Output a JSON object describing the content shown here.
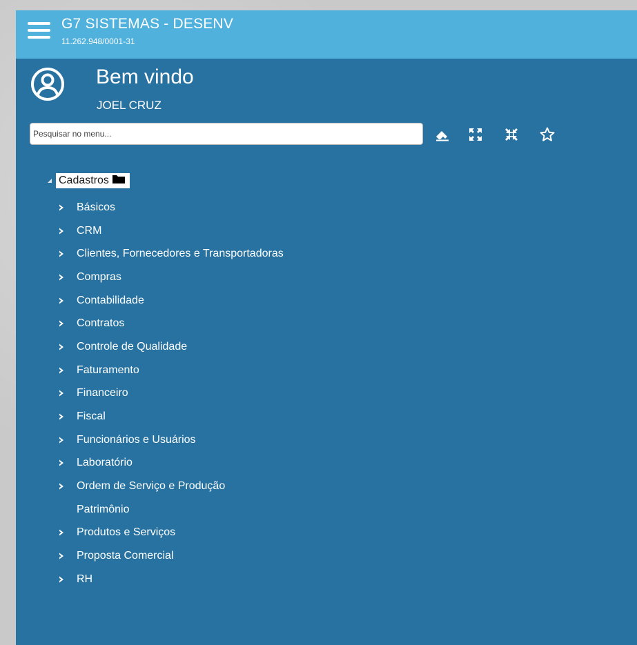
{
  "header": {
    "title": "G7 SISTEMAS - DESENV",
    "subtitle": "11.262.948/0001-31",
    "menu_icon": "hamburger-menu-icon"
  },
  "profile": {
    "welcome": "Bem vindo",
    "user": "JOEL CRUZ",
    "avatar_icon": "user-circle-icon"
  },
  "search": {
    "placeholder": "Pesquisar no menu...",
    "value": "",
    "tools": [
      {
        "name": "clear-search-eraser-icon"
      },
      {
        "name": "expand-all-icon"
      },
      {
        "name": "collapse-all-icon"
      },
      {
        "name": "favorites-star-icon"
      }
    ]
  },
  "tree": {
    "root": {
      "label": "Cadastros",
      "expanded": true,
      "icon": "folder-icon"
    },
    "items": [
      {
        "label": "Básicos",
        "has_children": true
      },
      {
        "label": "CRM",
        "has_children": true
      },
      {
        "label": "Clientes, Fornecedores e Transportadoras",
        "has_children": true
      },
      {
        "label": "Compras",
        "has_children": true
      },
      {
        "label": "Contabilidade",
        "has_children": true
      },
      {
        "label": "Contratos",
        "has_children": true
      },
      {
        "label": "Controle de Qualidade",
        "has_children": true
      },
      {
        "label": "Faturamento",
        "has_children": true
      },
      {
        "label": "Financeiro",
        "has_children": true
      },
      {
        "label": "Fiscal",
        "has_children": true
      },
      {
        "label": "Funcionários e Usuários",
        "has_children": true
      },
      {
        "label": "Laboratório",
        "has_children": true
      },
      {
        "label": "Ordem de Serviço e Produção",
        "has_children": true
      },
      {
        "label": "Patrimônio",
        "has_children": false
      },
      {
        "label": "Produtos e Serviços",
        "has_children": true
      },
      {
        "label": "Proposta Comercial",
        "has_children": true
      },
      {
        "label": "RH",
        "has_children": true
      }
    ]
  },
  "colors": {
    "header_bg": "#4fb1dc",
    "panel_bg": "#2772a0",
    "text": "#ffffff"
  }
}
